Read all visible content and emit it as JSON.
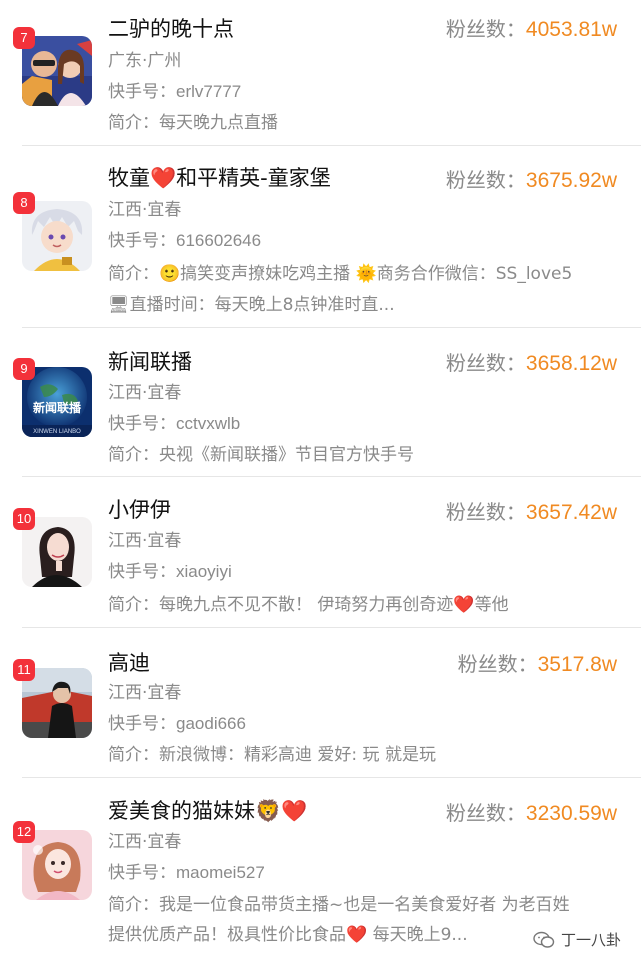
{
  "list": [
    {
      "rank": "7",
      "name": "二驴的晚十点",
      "name_emoji": "",
      "fans_label": "粉丝数：",
      "fans_value": "4053.81w",
      "location": "广东·广州",
      "id_label": "快手号：",
      "id_value": "erlv7777",
      "bio_label": "简介：",
      "bio_line1": "每天晚九点直播",
      "bio_line2": "",
      "avatar": "man-woman-photo"
    },
    {
      "rank": "8",
      "name": "牧童❤️和平精英-童家堡",
      "name_emoji": "",
      "fans_label": "粉丝数：",
      "fans_value": "3675.92w",
      "location": "江西·宜春",
      "id_label": "快手号：",
      "id_value": "616602646",
      "bio_label": "简介：",
      "bio_line1": "🙂搞笑变声撩妹吃鸡主播 🌞商务合作微信：SS_love5",
      "bio_line2": "🖥直播时间：每天晚上8点钟准时直...",
      "avatar": "anime-boy"
    },
    {
      "rank": "9",
      "name": "新闻联播",
      "name_emoji": "",
      "fans_label": "粉丝数：",
      "fans_value": "3658.12w",
      "location": "江西·宜春",
      "id_label": "快手号：",
      "id_value": "cctvxwlb",
      "bio_label": "简介：",
      "bio_line1": "央视《新闻联播》节目官方快手号",
      "bio_line2": "",
      "avatar": "news-logo",
      "avatar_text": "新闻联播",
      "avatar_subtext": "XINWEN LIANBO"
    },
    {
      "rank": "10",
      "name": "小伊伊",
      "name_emoji": "",
      "fans_label": "粉丝数：",
      "fans_value": "3657.42w",
      "location": "江西·宜春",
      "id_label": "快手号：",
      "id_value": "xiaoyiyi",
      "bio_label": "简介：",
      "bio_line1": "每晚九点不见不散！ 伊琦努力再创奇迹❤️等他",
      "bio_line2": "",
      "avatar": "woman-portrait"
    },
    {
      "rank": "11",
      "name": "高迪",
      "name_emoji": "",
      "fans_label": "粉丝数：",
      "fans_value": "3517.8w",
      "location": "江西·宜春",
      "id_label": "快手号：",
      "id_value": "gaodi666",
      "bio_label": "简介：",
      "bio_line1": "新浪微博：精彩高迪 爱好: 玩 就是玩",
      "bio_line2": "",
      "avatar": "man-car-photo"
    },
    {
      "rank": "12",
      "name": "爱美食的猫妹妹🦁❤️",
      "name_emoji": "",
      "fans_label": "粉丝数：",
      "fans_value": "3230.59w",
      "location": "江西·宜春",
      "id_label": "快手号：",
      "id_value": "maomei527",
      "bio_label": "简介：",
      "bio_line1": "我是一位食品带货主播~也是一名美食爱好者 为老百姓",
      "bio_line2": "提供优质产品！极具性价比食品❤️ 每天晚上9...",
      "avatar": "girl-pink-photo"
    }
  ],
  "watermark": {
    "text": "丁一八卦"
  },
  "colors": {
    "accent_orange": "#f08a22",
    "badge_red": "#f3313a",
    "muted_gray": "#8a8a8a"
  }
}
